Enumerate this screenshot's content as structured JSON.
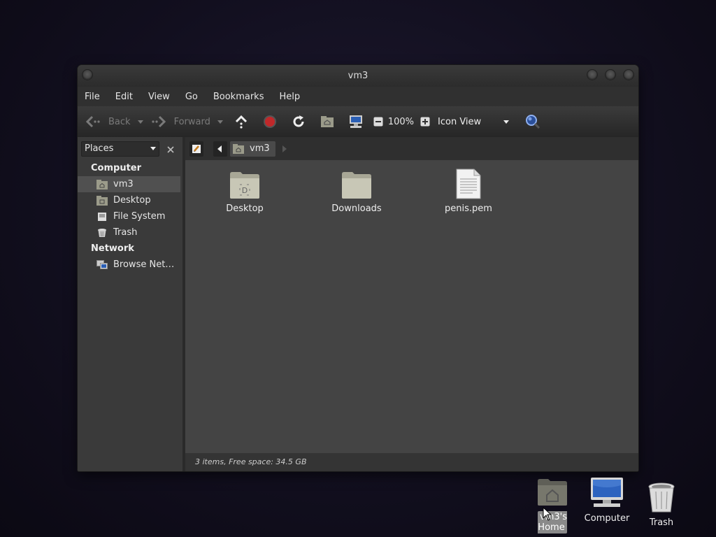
{
  "window": {
    "title": "vm3",
    "menu": [
      "File",
      "Edit",
      "View",
      "Go",
      "Bookmarks",
      "Help"
    ],
    "toolbar": {
      "back_label": "Back",
      "forward_label": "Forward",
      "zoom": "100%",
      "view_mode": "Icon View",
      "icons": [
        "back-arrow-icon",
        "forward-arrow-icon",
        "up-icon",
        "stop-icon",
        "reload-icon",
        "home-icon",
        "computer-icon",
        "zoom-out-icon",
        "zoom-in-icon",
        "search-icon"
      ]
    },
    "sidebar": {
      "selector": "Places",
      "sections": [
        {
          "title": "Computer",
          "items": [
            {
              "label": "vm3",
              "icon": "home-folder-icon",
              "selected": true
            },
            {
              "label": "Desktop",
              "icon": "desktop-icon"
            },
            {
              "label": "File System",
              "icon": "drive-icon"
            },
            {
              "label": "Trash",
              "icon": "trash-icon"
            }
          ]
        },
        {
          "title": "Network",
          "items": [
            {
              "label": "Browse Net…",
              "icon": "network-icon"
            }
          ]
        }
      ]
    },
    "pathbar": {
      "current": "vm3"
    },
    "files": [
      {
        "name": "Desktop",
        "icon": "desktop-folder-icon"
      },
      {
        "name": "Downloads",
        "icon": "folder-icon"
      },
      {
        "name": "penis.pem",
        "icon": "text-file-icon"
      }
    ],
    "status": "3 items, Free space: 34.5 GB"
  },
  "desktop": {
    "icons": [
      {
        "label": "vm3's Home",
        "icon": "home-folder-icon",
        "selected": true
      },
      {
        "label": "Computer",
        "icon": "computer-icon"
      },
      {
        "label": "Trash",
        "icon": "trash-icon"
      }
    ]
  },
  "colors": {
    "window_bg": "#3c3c3c",
    "content_bg": "#444444",
    "stop_red": "#c0282a",
    "search_blue": "#3a6fd0"
  }
}
